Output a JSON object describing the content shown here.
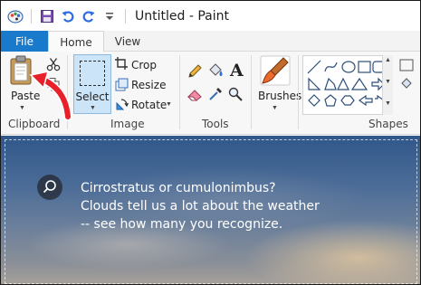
{
  "window": {
    "title": "Untitled - Paint"
  },
  "quick_access": {
    "icons": [
      "paint-app-icon",
      "save-icon",
      "undo-icon",
      "redo-icon",
      "customize-dropdown-icon"
    ]
  },
  "tabs": [
    {
      "label": "File"
    },
    {
      "label": "Home"
    },
    {
      "label": "View"
    }
  ],
  "ribbon": {
    "clipboard": {
      "paste_label": "Paste",
      "group_label": "Clipboard"
    },
    "image": {
      "select_label": "Select",
      "crop_label": "Crop",
      "resize_label": "Resize",
      "rotate_label": "Rotate",
      "group_label": "Image"
    },
    "tools": {
      "group_label": "Tools"
    },
    "brushes": {
      "label": "Brushes"
    },
    "shapes": {
      "group_label": "Shapes"
    }
  },
  "canvas": {
    "lines": [
      "Cirrostratus or cumulonimbus?",
      "Clouds tell us a lot about the weather",
      "-- see how many you recognize."
    ]
  },
  "colors": {
    "accent": "#1979ca",
    "selected": "#cce4f7",
    "arrow": "#e8202a"
  }
}
